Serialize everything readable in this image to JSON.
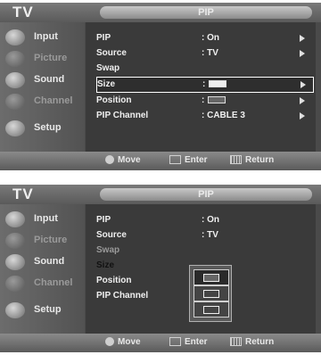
{
  "screens": [
    {
      "header_left": "TV",
      "header_title": "PIP",
      "sidebar": [
        {
          "label": "Input",
          "icon": "input-icon",
          "dim": false
        },
        {
          "label": "Picture",
          "icon": "picture-icon",
          "dim": true
        },
        {
          "label": "Sound",
          "icon": "sound-icon",
          "dim": false
        },
        {
          "label": "Channel",
          "icon": "channel-icon",
          "dim": true
        },
        {
          "label": "Setup",
          "icon": "setup-icon",
          "dim": false
        }
      ],
      "rows": [
        {
          "label": "PIP",
          "value": ": On",
          "arrow": true
        },
        {
          "label": "Source",
          "value": ": TV",
          "arrow": true
        },
        {
          "label": "Swap",
          "value": "",
          "arrow": false
        },
        {
          "label": "Size",
          "value": ":",
          "arrow": true
        },
        {
          "label": "Position",
          "value": ":",
          "arrow": true
        },
        {
          "label": "PIP Channel",
          "value": ": CABLE 3",
          "arrow": true
        }
      ],
      "footer": {
        "move": "Move",
        "enter": "Enter",
        "return": "Return"
      }
    },
    {
      "header_left": "TV",
      "header_title": "PIP",
      "sidebar": [
        {
          "label": "Input",
          "icon": "input-icon",
          "dim": false
        },
        {
          "label": "Picture",
          "icon": "picture-icon",
          "dim": true
        },
        {
          "label": "Sound",
          "icon": "sound-icon",
          "dim": false
        },
        {
          "label": "Channel",
          "icon": "channel-icon",
          "dim": true
        },
        {
          "label": "Setup",
          "icon": "setup-icon",
          "dim": false
        }
      ],
      "rows": [
        {
          "label": "PIP",
          "value": ": On"
        },
        {
          "label": "Source",
          "value": ": TV"
        },
        {
          "label": "Swap",
          "value": ""
        },
        {
          "label": "Size",
          "value": ""
        },
        {
          "label": "Position",
          "value": ":"
        },
        {
          "label": "PIP Channel",
          "value": ":"
        }
      ],
      "footer": {
        "move": "Move",
        "enter": "Enter",
        "return": "Return"
      }
    }
  ],
  "colors": {
    "background": "#4a4a4a",
    "panel": "#3a3a3a",
    "highlight_border": "#ffffff"
  }
}
